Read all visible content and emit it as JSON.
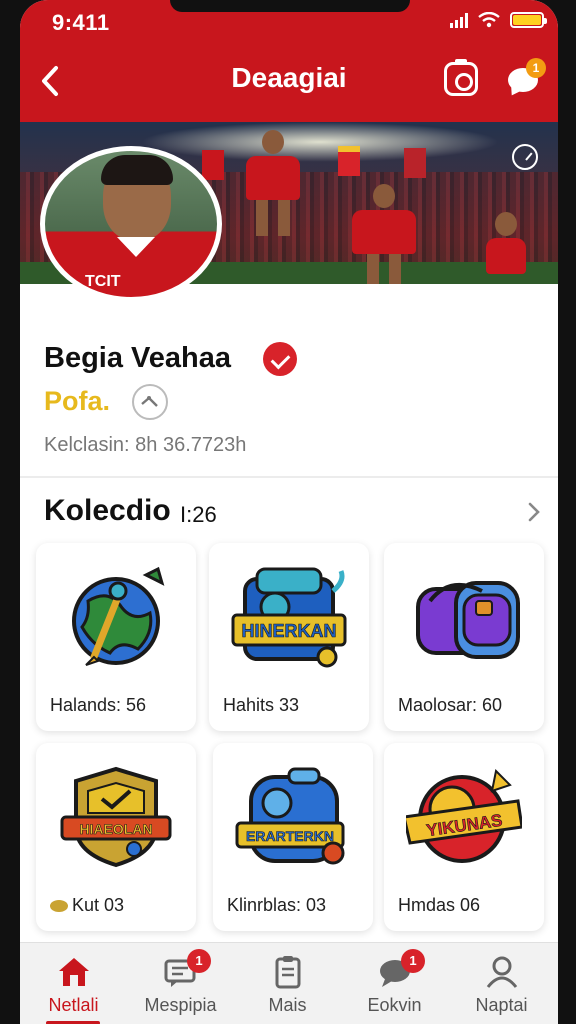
{
  "status_bar": {
    "time": "9:411"
  },
  "header": {
    "title": "Deaagiai",
    "chat_badge": "1"
  },
  "profile": {
    "name": "Begia Veahaa",
    "rank": "Pofa.",
    "subline": "Kelclasin: 8h 36.7723h",
    "shirt_text": "TCIT"
  },
  "collection": {
    "title": "Kolecdio",
    "count": "I:26",
    "items": [
      {
        "label": "Halands: 56",
        "icon": "globe-sword-badge-icon",
        "colors": [
          "#2f8a3a",
          "#2d6fd1",
          "#e0a72a"
        ]
      },
      {
        "label": "Hahits 33",
        "icon": "hinerkan-badge-icon",
        "art_text": "HINERKAN",
        "colors": [
          "#1e5fbf",
          "#e7c02a",
          "#3ab0c8"
        ]
      },
      {
        "label": "Maolosar: 60",
        "icon": "backpack-badge-icon",
        "colors": [
          "#7a3bd1",
          "#4a8fe0",
          "#e0902a"
        ]
      },
      {
        "label": "Kut 03",
        "icon": "shield-badge-icon",
        "art_text": "HIAEOLAN",
        "colors": [
          "#c9a332",
          "#d84a22",
          "#2a6fd1"
        ]
      },
      {
        "label": "Klinrblas: 03",
        "icon": "erarterkn-badge-icon",
        "art_text": "ERARTERKN",
        "colors": [
          "#2a6fd1",
          "#e7c02a",
          "#d84a22"
        ]
      },
      {
        "label": "Hmdas 06",
        "icon": "yikunas-badge-icon",
        "art_text": "YIKUNAS",
        "colors": [
          "#d8232a",
          "#f2c12e",
          "#1a1a1a"
        ]
      }
    ]
  },
  "bottom_nav": [
    {
      "label": "Netlali",
      "icon": "home-icon",
      "active": true
    },
    {
      "label": "Mespipia",
      "icon": "messages-icon",
      "badge": "1"
    },
    {
      "label": "Mais",
      "icon": "clipboard-icon"
    },
    {
      "label": "Eokvin",
      "icon": "chat-icon",
      "badge": "1"
    },
    {
      "label": "Naptai",
      "icon": "profile-icon"
    }
  ],
  "colors": {
    "brand_red": "#c8161d",
    "rank_gold": "#e7b91d",
    "badge_orange": "#f39c12"
  }
}
